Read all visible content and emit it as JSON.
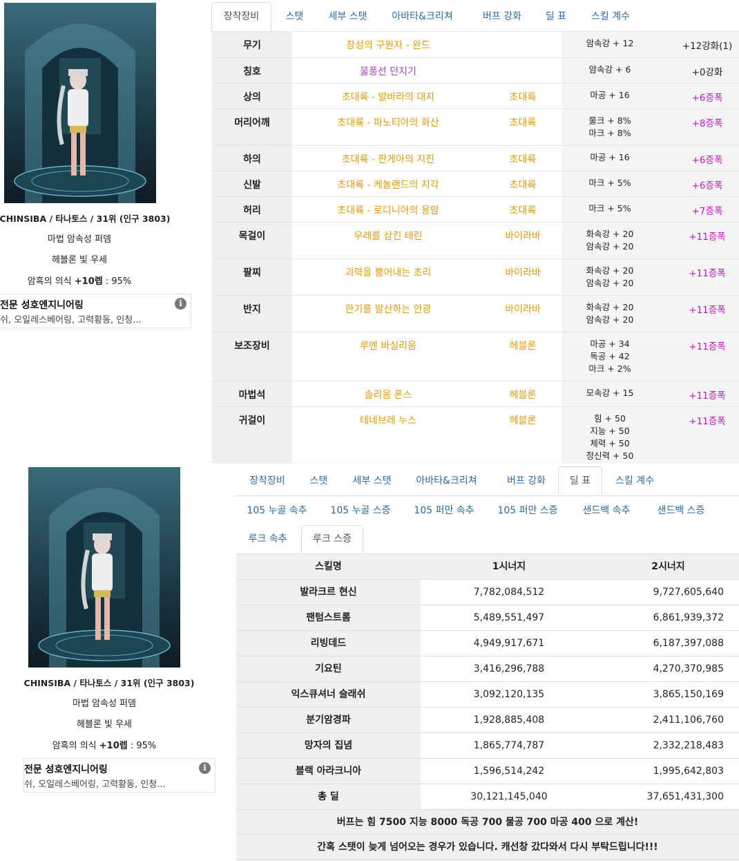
{
  "character": {
    "name_line": "CHINSIBA / 타나토스 / 31위 (인구 3803)",
    "job": "마법 암속성 퍼뎀",
    "set_line": "헤블론 빛 우세",
    "awaken_prefix": "암흑의 의식 ",
    "awaken_bold": "+10렙",
    "awaken_suffix": " : 95%",
    "info_title": "전문 성호엔지니어링",
    "info_sub": "쉬, 오일레스베어링, 고력황동, 인청...",
    "info_icon": "i"
  },
  "tabs": [
    "장착장비",
    "스탯",
    "세부 스탯",
    "아바타&크리쳐",
    "버프 강화",
    "딜 표",
    "스킬 계수"
  ],
  "equipment": [
    {
      "slot": "무기",
      "item": "창성의 구원자 - 완드",
      "rarity": "epic",
      "set": "",
      "stats": [
        "암속강 + 12"
      ],
      "enh": "+12강화(1)",
      "enh_type": "norm"
    },
    {
      "slot": "칭호",
      "item": "물풍선 던지기",
      "rarity": "rare",
      "set": "",
      "stats": [
        "암속강 + 6"
      ],
      "enh": "+0강화",
      "enh_type": "norm"
    },
    {
      "slot": "상의",
      "item": "초대륙 - 발바라의 대지",
      "rarity": "epic",
      "set": "초대륙",
      "stats": [
        "마공 + 16"
      ],
      "enh": "+6증폭",
      "enh_type": "amp"
    },
    {
      "slot": "머리어깨",
      "item": "초대륙 - 파노티아의 화산",
      "rarity": "epic",
      "set": "초대륙",
      "stats": [
        "물크 + 8%",
        "마크 + 8%"
      ],
      "enh": "+8증폭",
      "enh_type": "amp"
    },
    {
      "slot": "하의",
      "item": "초대륙 - 판게아의 지진",
      "rarity": "epic",
      "set": "초대륙",
      "stats": [
        "마공 + 16"
      ],
      "enh": "+6증폭",
      "enh_type": "amp"
    },
    {
      "slot": "신발",
      "item": "초대륙 - 케놀랜드의 지각",
      "rarity": "epic",
      "set": "초대륙",
      "stats": [
        "마크 + 5%"
      ],
      "enh": "+6증폭",
      "enh_type": "amp"
    },
    {
      "slot": "허리",
      "item": "초대륙 - 로디니아의 용암",
      "rarity": "epic",
      "set": "초대륙",
      "stats": [
        "마크 + 5%"
      ],
      "enh": "+7증폭",
      "enh_type": "amp"
    },
    {
      "slot": "목걸이",
      "item": "우레를 삼킨 태린",
      "rarity": "epic",
      "set": "바이라바",
      "stats": [
        "화속강 + 20",
        "암속강 + 20"
      ],
      "enh": "+11증폭",
      "enh_type": "amp"
    },
    {
      "slot": "팔찌",
      "item": "괴력을 뿜어내는 초리",
      "rarity": "epic",
      "set": "바이라바",
      "stats": [
        "화속강 + 20",
        "암속강 + 20"
      ],
      "enh": "+11증폭",
      "enh_type": "amp"
    },
    {
      "slot": "반지",
      "item": "한기를 발산하는 안광",
      "rarity": "epic",
      "set": "바이라바",
      "stats": [
        "화속강 + 20",
        "암속강 + 20"
      ],
      "enh": "+11증폭",
      "enh_type": "amp"
    },
    {
      "slot": "보조장비",
      "item": "루멘 바실리움",
      "rarity": "epic",
      "set": "헤블론",
      "stats": [
        "마공 + 34",
        "독공 + 42",
        "마크 + 2%"
      ],
      "enh": "+11증폭",
      "enh_type": "amp"
    },
    {
      "slot": "마법석",
      "item": "솔리움 폰스",
      "rarity": "epic",
      "set": "헤블론",
      "stats": [
        "모속강 + 15"
      ],
      "enh": "+11증폭",
      "enh_type": "amp"
    },
    {
      "slot": "귀걸이",
      "item": "테네브레 누스",
      "rarity": "epic",
      "set": "헤블론",
      "stats": [
        "힘 + 50",
        "지능 + 50",
        "체력 + 50",
        "정신력 + 50"
      ],
      "enh": "+11증폭",
      "enh_type": "amp"
    }
  ],
  "dps_subtabs": [
    "105 누골 속추",
    "105 누골 스증",
    "105 퍼만 속추",
    "105 퍼만 스증",
    "샌드백 속추",
    "샌드백 스증",
    "루크 속추",
    "루크 스증"
  ],
  "dps_table": {
    "headers": [
      "스킬명",
      "1시너지",
      "2시너지"
    ],
    "rows": [
      [
        "발라크르 현신",
        "7,782,084,512",
        "9,727,605,640"
      ],
      [
        "팬텀스트롬",
        "5,489,551,497",
        "6,861,939,372"
      ],
      [
        "리빙데드",
        "4,949,917,671",
        "6,187,397,088"
      ],
      [
        "기요틴",
        "3,416,296,788",
        "4,270,370,985"
      ],
      [
        "익스큐셔너 슬래쉬",
        "3,092,120,135",
        "3,865,150,169"
      ],
      [
        "분기암경파",
        "1,928,885,408",
        "2,411,106,760"
      ],
      [
        "망자의 집념",
        "1,865,774,787",
        "2,332,218,483"
      ],
      [
        "블랙 아라크니아",
        "1,596,514,242",
        "1,995,642,803"
      ],
      [
        "총 딜",
        "30,121,145,040",
        "37,651,431,300"
      ]
    ],
    "notes": [
      "버프는 힘 7500 지능 8000 독공 700 물공 700 마공 400 으로 계산!",
      "간혹 스탯이 늦게 넘어오는 경우가 있습니다. 캐선창 갔다와서 다시 부탁드립니다!!!"
    ]
  },
  "colors": {
    "epic": "#e39a0a",
    "rare": "#b040c8",
    "amplify": "#c214c2",
    "tab_link": "#2a6aa5"
  }
}
